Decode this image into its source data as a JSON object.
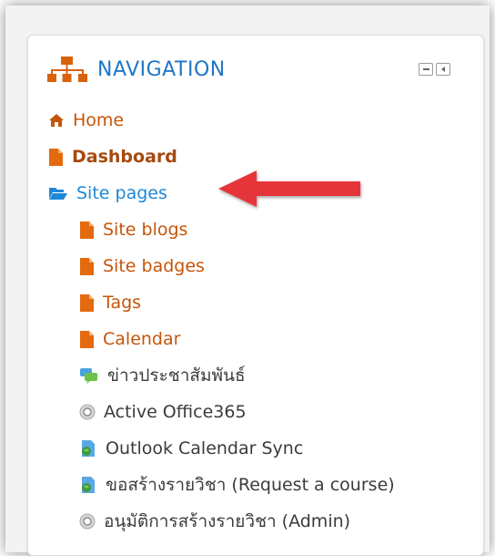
{
  "block": {
    "title": "NAVIGATION",
    "controls": [
      "minimize-icon",
      "dock-icon"
    ]
  },
  "nav": {
    "home": {
      "label": "Home",
      "icon": "home-icon"
    },
    "dashboard": {
      "label": "Dashboard",
      "icon": "page-icon"
    },
    "site_pages": {
      "label": "Site pages",
      "icon": "folder-open-icon"
    },
    "children": [
      {
        "label": "Site blogs",
        "icon": "page-icon"
      },
      {
        "label": "Site badges",
        "icon": "page-icon"
      },
      {
        "label": "Tags",
        "icon": "page-icon"
      },
      {
        "label": "Calendar",
        "icon": "page-icon"
      },
      {
        "label": "ข่าวประชาสัมพันธ์",
        "icon": "forum-chat-icon"
      },
      {
        "label": "Active Office365",
        "icon": "gear-icon"
      },
      {
        "label": "Outlook Calendar Sync",
        "icon": "globe-page-icon"
      },
      {
        "label": "ขอสร้างรายวิชา (Request a course)",
        "icon": "globe-page-icon"
      },
      {
        "label": "อนุมัติการสร้างรายวิชา (Admin)",
        "icon": "gear-icon"
      }
    ]
  },
  "colors": {
    "title_blue": "#1e76c7",
    "link_orange": "#c5550a",
    "dashboard_brown": "#a54a0e",
    "site_pages_blue": "#1e88d6",
    "arrow_red": "#e5343a"
  }
}
